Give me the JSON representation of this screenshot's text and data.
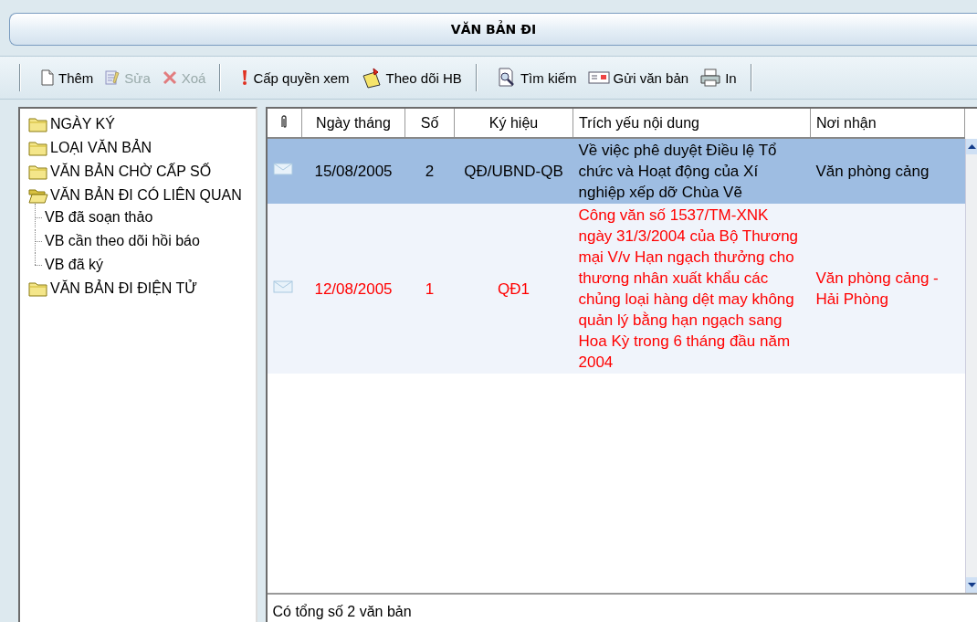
{
  "window": {
    "title": "VĂN BẢN ĐI"
  },
  "toolbar": {
    "groups": [
      [
        {
          "label": "Thêm",
          "disabled": false
        },
        {
          "label": "Sửa",
          "disabled": true
        },
        {
          "label": "Xoá",
          "disabled": true
        }
      ],
      [
        {
          "label": "Cấp quyền xem",
          "disabled": false
        },
        {
          "label": "Theo dõi HB",
          "disabled": false
        }
      ],
      [
        {
          "label": "Tìm kiếm",
          "disabled": false
        },
        {
          "label": "Gửi văn bản",
          "disabled": false
        },
        {
          "label": "In",
          "disabled": false
        }
      ]
    ]
  },
  "tree": {
    "items": [
      {
        "label": "NGÀY KÝ",
        "expanded": false
      },
      {
        "label": "LOẠI VĂN BẢN",
        "expanded": false
      },
      {
        "label": "VĂN BẢN CHỜ CẤP SỐ",
        "expanded": false
      },
      {
        "label": "VĂN BẢN ĐI CÓ LIÊN QUAN",
        "expanded": true,
        "children": [
          {
            "label": "VB đã soạn thảo"
          },
          {
            "label": "VB cần theo dõi hồi báo"
          },
          {
            "label": "VB đã ký"
          }
        ]
      },
      {
        "label": "VĂN BẢN ĐI ĐIỆN TỬ",
        "expanded": false
      }
    ]
  },
  "table": {
    "columns": [
      "Ngày tháng",
      "Số",
      "Ký hiệu",
      "Trích yếu nội dung",
      "Nơi nhận"
    ],
    "rows": [
      {
        "selected": true,
        "color": "#000000",
        "cells": [
          "15/08/2005",
          "2",
          "QĐ/UBND-QB",
          "Về việc phê duyệt Điều lệ Tổ chức và Hoạt động của Xí nghiệp xếp dỡ Chùa Vẽ",
          "Văn phòng cảng"
        ]
      },
      {
        "selected": false,
        "color": "#ff0000",
        "cells": [
          "12/08/2005",
          "1",
          "QĐ1",
          "Công văn số 1537/TM-XNK ngày 31/3/2004 của Bộ Thương mại V/v Hạn ngạch thưởng cho thương nhân xuất khẩu các chủng loại hàng dệt may không quản lý bằng hạn ngạch sang Hoa Kỳ trong 6 tháng đầu năm 2004",
          "Văn phòng cảng - Hải Phòng"
        ]
      }
    ]
  },
  "status_bar": {
    "text": "Có tổng số 2 văn bản"
  }
}
